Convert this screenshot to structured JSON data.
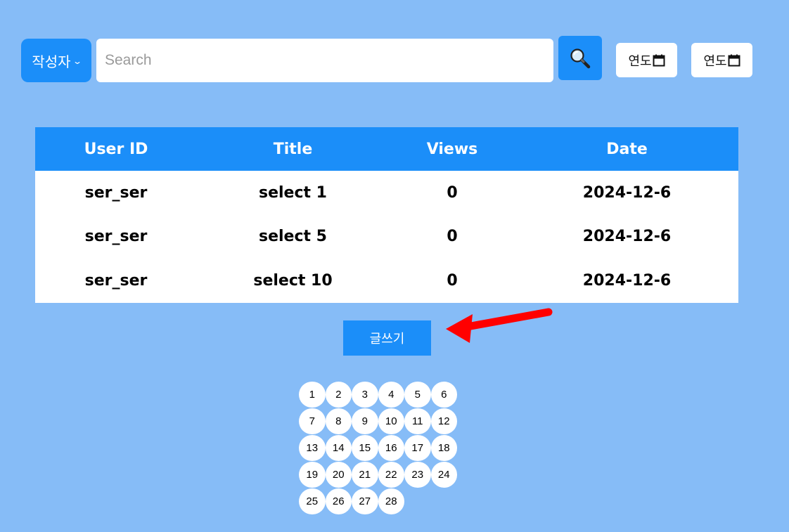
{
  "search_bar": {
    "filter_label": "작성자",
    "placeholder": "Search",
    "value": "",
    "date_start_text": "연도",
    "date_end_text": "연도"
  },
  "board": {
    "columns": [
      "User ID",
      "Title",
      "Views",
      "Date"
    ],
    "rows": [
      [
        "ser_ser",
        "select 1",
        "0",
        "2024-12-6"
      ],
      [
        "ser_ser",
        "select 5",
        "0",
        "2024-12-6"
      ],
      [
        "ser_ser",
        "select 10",
        "0",
        "2024-12-6"
      ]
    ]
  },
  "write_button_label": "글쓰기",
  "pagination": {
    "pages": [
      "1",
      "2",
      "3",
      "4",
      "5",
      "6",
      "7",
      "8",
      "9",
      "10",
      "11",
      "12",
      "13",
      "14",
      "15",
      "16",
      "17",
      "18",
      "19",
      "20",
      "21",
      "22",
      "23",
      "24",
      "25",
      "26",
      "27",
      "28"
    ]
  },
  "colors": {
    "background": "#86bcf7",
    "accent": "#1b8ef9",
    "annotation_arrow": "#ff0000"
  },
  "icons": {
    "filter_dropdown": "chevron-down-icon",
    "search": "magnifier-icon",
    "date": "calendar-icon"
  }
}
